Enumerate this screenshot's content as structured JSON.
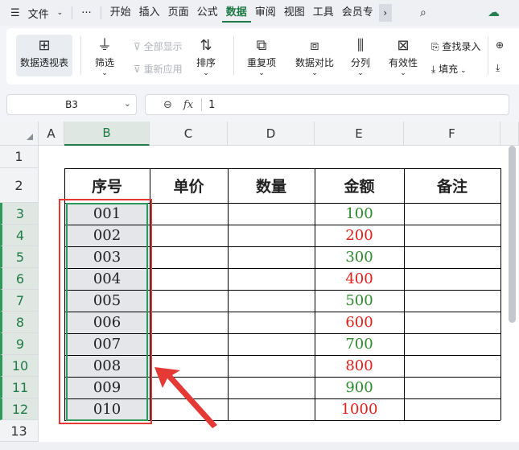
{
  "menubar": {
    "hamburger": "☰",
    "file": "文件",
    "more": "···",
    "tabs": [
      "开始",
      "插入",
      "页面",
      "公式",
      "数据",
      "审阅",
      "视图",
      "工具",
      "会员专"
    ],
    "active_tab": "数据",
    "overflow": "›"
  },
  "ribbon": {
    "pivot": "数据透视表",
    "filter": "筛选",
    "show_all": "全部显示",
    "reapply": "重新应用",
    "sort": "排序",
    "duplicates": "重复项",
    "compare": "数据对比",
    "split": "分列",
    "validity": "有效性",
    "find_entry": "查找录入",
    "fill": "填充"
  },
  "formula_bar": {
    "cell_ref": "B3",
    "fx": "fx",
    "value": "1"
  },
  "grid": {
    "columns": [
      "A",
      "B",
      "C",
      "D",
      "E",
      "F"
    ],
    "selected_column": "B",
    "rows": [
      "1",
      "2",
      "3",
      "4",
      "5",
      "6",
      "7",
      "8",
      "9",
      "10",
      "11",
      "12",
      "13"
    ],
    "table_headers": [
      "序号",
      "单价",
      "数量",
      "金额",
      "备注"
    ],
    "serials": [
      "001",
      "002",
      "003",
      "004",
      "005",
      "006",
      "007",
      "008",
      "009",
      "010"
    ],
    "amounts": [
      "100",
      "200",
      "300",
      "400",
      "500",
      "600",
      "700",
      "800",
      "900",
      "1000"
    ]
  },
  "colors": {
    "accent": "#1f7a45",
    "amount_green": "#2e8b2e",
    "amount_red": "#e0201b",
    "highlight_box": "#e53935"
  }
}
